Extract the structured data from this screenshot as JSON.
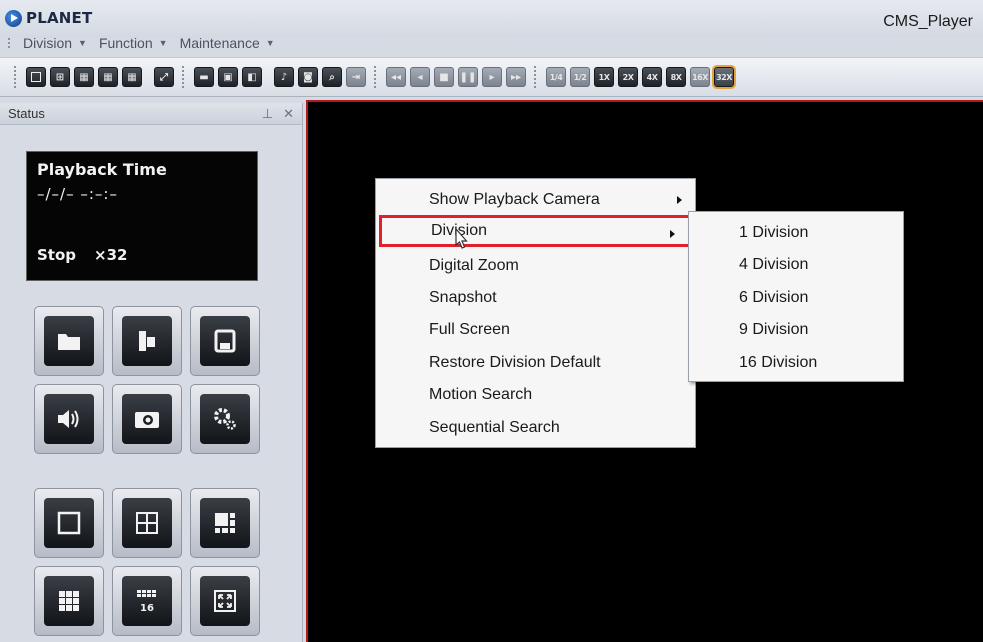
{
  "window": {
    "brand": "PLANET",
    "app_title": "CMS_Player"
  },
  "menubar": {
    "items": [
      {
        "label": "Division"
      },
      {
        "label": "Function"
      },
      {
        "label": "Maintenance"
      }
    ]
  },
  "toolbar": {
    "speed_buttons": [
      "1/4",
      "1/2",
      "1X",
      "2X",
      "4X",
      "8X",
      "16X",
      "32X"
    ],
    "active_speed": "32X"
  },
  "status_panel": {
    "title": "Status",
    "pin_glyph": "⊥",
    "close_glyph": "✕",
    "playback_title": "Playback Time",
    "playback_time": "–/–/– –:–:–",
    "state": "Stop",
    "speed": "×32"
  },
  "context_menu": {
    "items": [
      {
        "label": "Show Playback Camera",
        "has_submenu": true
      },
      {
        "label": "Division",
        "has_submenu": true,
        "highlighted": true
      },
      {
        "label": "Digital Zoom"
      },
      {
        "label": "Snapshot"
      },
      {
        "label": "Full Screen"
      },
      {
        "label": "Restore Division Default"
      },
      {
        "label": "Motion Search"
      },
      {
        "label": "Sequential Search"
      }
    ]
  },
  "division_submenu": {
    "items": [
      {
        "label": "1 Division"
      },
      {
        "label": "4 Division"
      },
      {
        "label": "6 Division"
      },
      {
        "label": "9 Division"
      },
      {
        "label": "16 Division"
      }
    ]
  },
  "colors": {
    "highlight_border": "#e0202a",
    "video_border": "#b01a1a",
    "active_speed_outline": "#e3a23a"
  }
}
